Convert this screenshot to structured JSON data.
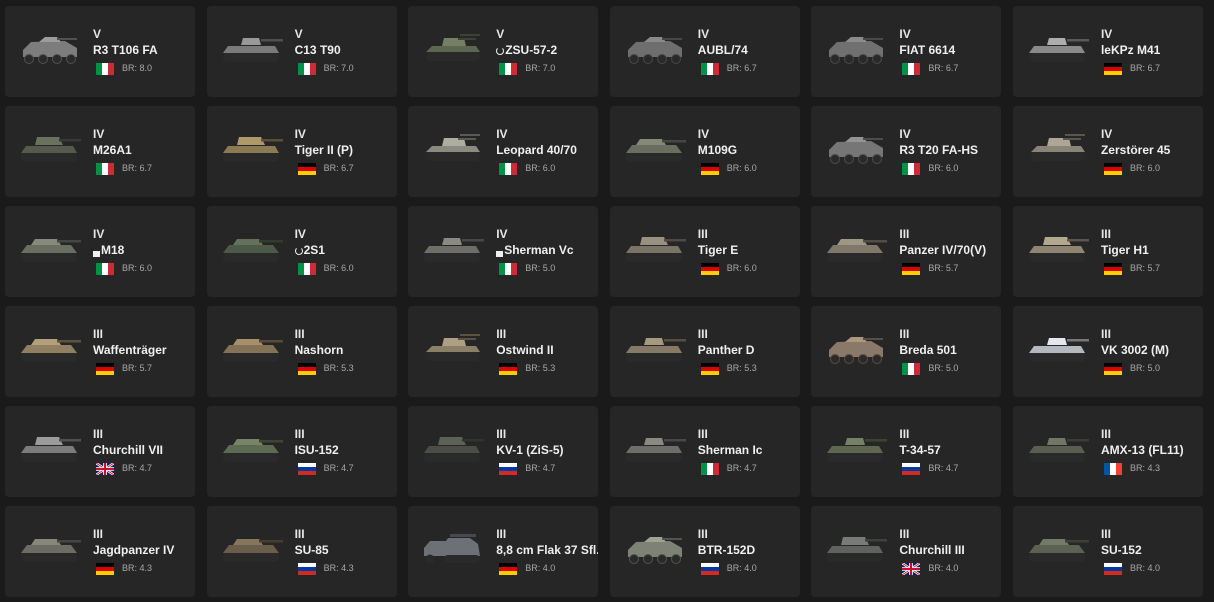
{
  "vehicles": [
    {
      "rank": "V",
      "name": "R3 T106 FA",
      "prefix": "",
      "country": "italy",
      "br": "BR: 8.0",
      "icon": "wheeled-armored-car-icon",
      "tone": "#7d7d7d"
    },
    {
      "rank": "V",
      "name": "C13 T90",
      "prefix": "",
      "country": "italy",
      "br": "BR: 7.0",
      "icon": "light-tank-icon",
      "tone": "#7a7a7a"
    },
    {
      "rank": "V",
      "name": "ZSU-57-2",
      "prefix": "event",
      "country": "italy",
      "br": "BR: 7.0",
      "icon": "spaa-icon",
      "tone": "#5c6650"
    },
    {
      "rank": "IV",
      "name": "AUBL/74",
      "prefix": "",
      "country": "italy",
      "br": "BR: 6.7",
      "icon": "wheeled-armored-car-icon",
      "tone": "#6e6e6e"
    },
    {
      "rank": "IV",
      "name": "FIAT 6614",
      "prefix": "",
      "country": "italy",
      "br": "BR: 6.7",
      "icon": "wheeled-armored-car-icon",
      "tone": "#707070"
    },
    {
      "rank": "IV",
      "name": "leKPz M41",
      "prefix": "",
      "country": "germany",
      "br": "BR: 6.7",
      "icon": "light-tank-icon",
      "tone": "#8a8a8a"
    },
    {
      "rank": "IV",
      "name": "M26A1",
      "prefix": "",
      "country": "italy",
      "br": "BR: 6.7",
      "icon": "heavy-tank-icon",
      "tone": "#555a4c"
    },
    {
      "rank": "IV",
      "name": "Tiger II (P)",
      "prefix": "",
      "country": "germany",
      "br": "BR: 6.7",
      "icon": "heavy-tank-icon",
      "tone": "#8c7a55"
    },
    {
      "rank": "IV",
      "name": "Leopard 40/70",
      "prefix": "",
      "country": "italy",
      "br": "BR: 6.0",
      "icon": "spaa-icon",
      "tone": "#8a8a80"
    },
    {
      "rank": "IV",
      "name": "M109G",
      "prefix": "",
      "country": "germany",
      "br": "BR: 6.0",
      "icon": "spg-icon",
      "tone": "#6a6e60"
    },
    {
      "rank": "IV",
      "name": "R3 T20 FA-HS",
      "prefix": "",
      "country": "italy",
      "br": "BR: 6.0",
      "icon": "wheeled-armored-car-icon",
      "tone": "#767676"
    },
    {
      "rank": "IV",
      "name": "Zerstörer 45",
      "prefix": "",
      "country": "germany",
      "br": "BR: 6.0",
      "icon": "spaa-icon",
      "tone": "#8a8478"
    },
    {
      "rank": "IV",
      "name": "M18",
      "prefix": "square",
      "country": "italy",
      "br": "BR: 6.0",
      "icon": "tank-destroyer-icon",
      "tone": "#6a6e62"
    },
    {
      "rank": "IV",
      "name": "2S1",
      "prefix": "event",
      "country": "italy",
      "br": "BR: 6.0",
      "icon": "spg-icon",
      "tone": "#4e5a48"
    },
    {
      "rank": "IV",
      "name": "Sherman Vc",
      "prefix": "square",
      "country": "italy",
      "br": "BR: 5.0",
      "icon": "medium-tank-icon",
      "tone": "#6e6e68"
    },
    {
      "rank": "III",
      "name": "Tiger E",
      "prefix": "",
      "country": "germany",
      "br": "BR: 6.0",
      "icon": "heavy-tank-icon",
      "tone": "#7a7466"
    },
    {
      "rank": "III",
      "name": "Panzer IV/70(V)",
      "prefix": "",
      "country": "germany",
      "br": "BR: 5.7",
      "icon": "tank-destroyer-icon",
      "tone": "#80786a"
    },
    {
      "rank": "III",
      "name": "Tiger H1",
      "prefix": "",
      "country": "germany",
      "br": "BR: 5.7",
      "icon": "heavy-tank-icon",
      "tone": "#8e8672"
    },
    {
      "rank": "III",
      "name": "Waffenträger",
      "prefix": "",
      "country": "germany",
      "br": "BR: 5.7",
      "icon": "tank-destroyer-icon",
      "tone": "#8e8060"
    },
    {
      "rank": "III",
      "name": "Nashorn",
      "prefix": "",
      "country": "germany",
      "br": "BR: 5.3",
      "icon": "tank-destroyer-icon",
      "tone": "#847256"
    },
    {
      "rank": "III",
      "name": "Ostwind II",
      "prefix": "",
      "country": "germany",
      "br": "BR: 5.3",
      "icon": "spaa-icon",
      "tone": "#8a8068"
    },
    {
      "rank": "III",
      "name": "Panther D",
      "prefix": "",
      "country": "germany",
      "br": "BR: 5.3",
      "icon": "medium-tank-icon",
      "tone": "#847a66"
    },
    {
      "rank": "III",
      "name": "Breda 501",
      "prefix": "",
      "country": "italy",
      "br": "BR: 5.0",
      "icon": "wheeled-armored-car-icon",
      "tone": "#8a7868"
    },
    {
      "rank": "III",
      "name": "VK 3002 (M)",
      "prefix": "",
      "country": "germany",
      "br": "BR: 5.0",
      "icon": "medium-tank-icon",
      "tone": "#b6b8c0"
    },
    {
      "rank": "III",
      "name": "Churchill VII",
      "prefix": "",
      "country": "uk",
      "br": "BR: 4.7",
      "icon": "heavy-tank-icon",
      "tone": "#7c7c7c"
    },
    {
      "rank": "III",
      "name": "ISU-152",
      "prefix": "",
      "country": "ussr",
      "br": "BR: 4.7",
      "icon": "tank-destroyer-icon",
      "tone": "#5e6a52"
    },
    {
      "rank": "III",
      "name": "KV-1 (ZiS-5)",
      "prefix": "",
      "country": "ussr",
      "br": "BR: 4.7",
      "icon": "heavy-tank-icon",
      "tone": "#4a4e46"
    },
    {
      "rank": "III",
      "name": "Sherman Ic",
      "prefix": "",
      "country": "italy",
      "br": "BR: 4.7",
      "icon": "medium-tank-icon",
      "tone": "#6e6e68"
    },
    {
      "rank": "III",
      "name": "T-34-57",
      "prefix": "",
      "country": "ussr",
      "br": "BR: 4.7",
      "icon": "medium-tank-icon",
      "tone": "#5e6650"
    },
    {
      "rank": "III",
      "name": "AMX-13 (FL11)",
      "prefix": "",
      "country": "france",
      "br": "BR: 4.3",
      "icon": "light-tank-icon",
      "tone": "#5a5e52"
    },
    {
      "rank": "III",
      "name": "Jagdpanzer IV",
      "prefix": "",
      "country": "germany",
      "br": "BR: 4.3",
      "icon": "tank-destroyer-icon",
      "tone": "#6c6c64"
    },
    {
      "rank": "III",
      "name": "SU-85",
      "prefix": "",
      "country": "ussr",
      "br": "BR: 4.3",
      "icon": "tank-destroyer-icon",
      "tone": "#6a5e4a"
    },
    {
      "rank": "III",
      "name": "8,8 cm Flak 37 Sfl.",
      "prefix": "",
      "country": "germany",
      "br": "BR: 4.0",
      "icon": "half-track-icon",
      "tone": "#6e7078"
    },
    {
      "rank": "III",
      "name": "BTR-152D",
      "prefix": "",
      "country": "ussr",
      "br": "BR: 4.0",
      "icon": "wheeled-armored-car-icon",
      "tone": "#7e8276"
    },
    {
      "rank": "III",
      "name": "Churchill III",
      "prefix": "",
      "country": "uk",
      "br": "BR: 4.0",
      "icon": "heavy-tank-icon",
      "tone": "#606260"
    },
    {
      "rank": "III",
      "name": "SU-152",
      "prefix": "",
      "country": "ussr",
      "br": "BR: 4.0",
      "icon": "tank-destroyer-icon",
      "tone": "#5c6252"
    }
  ],
  "flags": {
    "italy": [
      "#009246",
      "#ffffff",
      "#ce2b37"
    ],
    "germany": [
      "#000000",
      "#dd0000",
      "#ffce00"
    ],
    "ussr": [
      "#ffffff",
      "#0039a6",
      "#d52b1e"
    ],
    "france": [
      "#0055a4",
      "#ffffff",
      "#ef4135"
    ],
    "uk": [
      "#012169",
      "#ffffff",
      "#c8102e"
    ]
  }
}
